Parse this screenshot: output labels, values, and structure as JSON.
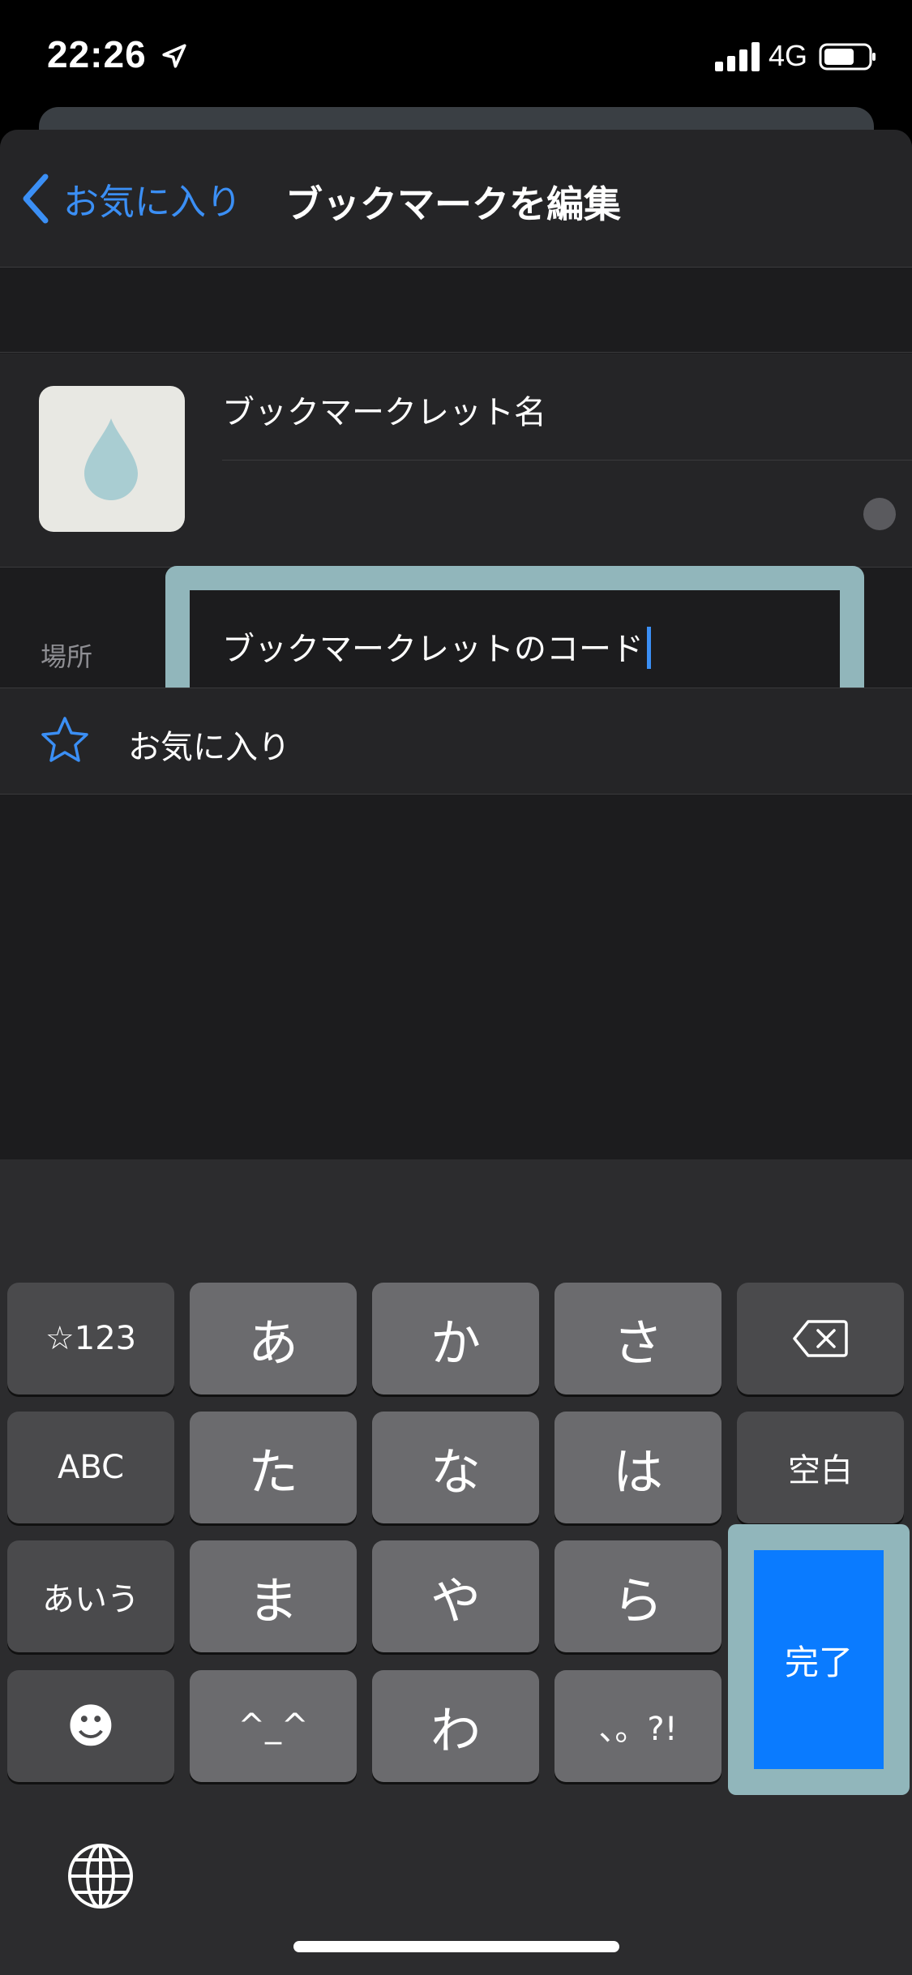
{
  "status_bar": {
    "time": "22:26",
    "network": "4G",
    "location_icon": "location-arrow-icon",
    "signal_icon": "cellular-signal-icon",
    "battery_icon": "battery-icon"
  },
  "nav": {
    "back_label": "お気に入り",
    "title": "ブックマークを編集"
  },
  "form": {
    "name_value": "ブックマークレット名",
    "code_value": "ブックマークレットのコード"
  },
  "location": {
    "section_label": "場所",
    "folder": "お気に入り"
  },
  "keyboard": {
    "rows": [
      [
        "☆123",
        "あ",
        "か",
        "さ",
        "⌫"
      ],
      [
        "ABC",
        "た",
        "な",
        "は",
        "空白"
      ],
      [
        "あいう",
        "ま",
        "や",
        "ら"
      ],
      [
        "☻",
        "^_^",
        "わ",
        "、。?!"
      ]
    ],
    "done_label": "完了"
  },
  "colors": {
    "accent": "#3b8ff5",
    "done_key": "#0a7bff",
    "highlight": "#91b6bb"
  }
}
